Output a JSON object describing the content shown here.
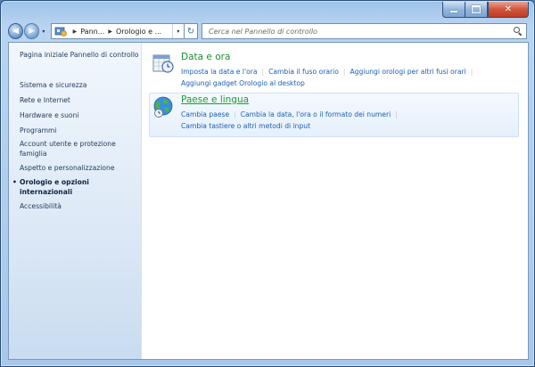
{
  "window": {
    "caption_buttons": {
      "minimize": "",
      "maximize": "",
      "close": "✕"
    }
  },
  "nav": {
    "back_glyph": "◀",
    "forward_glyph": "▶",
    "dropdown_glyph": "▾",
    "breadcrumb": [
      "Pann...",
      "Orologio e ..."
    ],
    "refresh_glyph": "↻",
    "search_placeholder": "Cerca nel Pannello di controllo"
  },
  "sidebar": {
    "items": [
      {
        "label": "Pagina iniziale Pannello di controllo"
      },
      {
        "label": "Sistema e sicurezza"
      },
      {
        "label": "Rete e Internet"
      },
      {
        "label": "Hardware e suoni"
      },
      {
        "label": "Programmi"
      },
      {
        "label": "Account utente e protezione famiglia"
      },
      {
        "label": "Aspetto e personalizzazione"
      },
      {
        "label": "Orologio e opzioni internazionali",
        "active": true,
        "bullet": "•"
      },
      {
        "label": "Accessibilità"
      }
    ]
  },
  "categories": [
    {
      "title": "Data e ora",
      "icon": "calendar-clock-icon",
      "links_row1": [
        "Imposta la data e l'ora",
        "Cambia il fuso orario",
        "Aggiungi orologi per altri fusi orari"
      ],
      "links_row2": [
        "Aggiungi gadget Orologio al desktop"
      ]
    },
    {
      "title": "Paese e lingua",
      "icon": "globe-clock-icon",
      "links_row1": [
        "Cambia paese",
        "Cambia la data, l'ora o il formato dei numeri"
      ],
      "links_row2": [
        "Cambia tastiere o altri metodi di input"
      ]
    }
  ],
  "colors": {
    "category_title": "#1d8c2a",
    "link": "#1a5fb4",
    "sidebar_text": "#1e395b"
  }
}
